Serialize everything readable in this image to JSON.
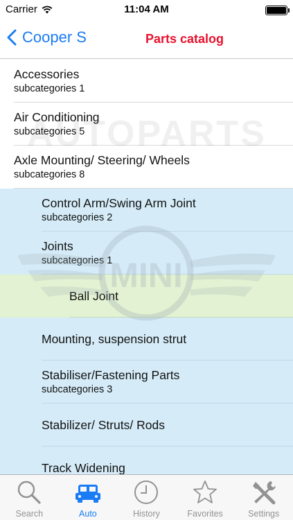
{
  "status_bar": {
    "carrier": "Carrier",
    "time": "11:04 AM",
    "battery_level": 1.0
  },
  "nav": {
    "back_label": "Cooper S",
    "title": "Parts catalog"
  },
  "watermark": {
    "brand_text": "AUTOPARTS",
    "logo_text": "MINI"
  },
  "list": {
    "rows": [
      {
        "title": "Accessories",
        "subtitle": "subcategories 1",
        "level": 0
      },
      {
        "title": "Air Conditioning",
        "subtitle": "subcategories 5",
        "level": 0
      },
      {
        "title": "Axle Mounting/ Steering/ Wheels",
        "subtitle": "subcategories 8",
        "level": 0
      },
      {
        "title": "Control Arm/Swing Arm Joint",
        "subtitle": "subcategories 2",
        "level": 1
      },
      {
        "title": "Joints",
        "subtitle": "subcategories 1",
        "level": 1
      },
      {
        "title": "Ball Joint",
        "subtitle": "",
        "level": 2
      },
      {
        "title": "Mounting, suspension strut",
        "subtitle": "",
        "level": 1
      },
      {
        "title": "Stabiliser/Fastening Parts",
        "subtitle": "subcategories 3",
        "level": 1
      },
      {
        "title": "Stabilizer/ Struts/ Rods",
        "subtitle": "",
        "level": 1
      },
      {
        "title": "Track Widening",
        "subtitle": "",
        "level": 1
      }
    ]
  },
  "tabs": [
    {
      "label": "Search",
      "icon": "magnifier-icon",
      "active": false
    },
    {
      "label": "Auto",
      "icon": "car-icon",
      "active": true
    },
    {
      "label": "History",
      "icon": "clock-icon",
      "active": false
    },
    {
      "label": "Favorites",
      "icon": "star-icon",
      "active": false
    },
    {
      "label": "Settings",
      "icon": "tools-icon",
      "active": false
    }
  ],
  "colors": {
    "accent": "#1a7cf5",
    "title_red": "#e8122d",
    "subcategory_bg": "#d5ecf8",
    "selected_bg": "#e3f2d2",
    "tab_inactive": "#929292"
  }
}
